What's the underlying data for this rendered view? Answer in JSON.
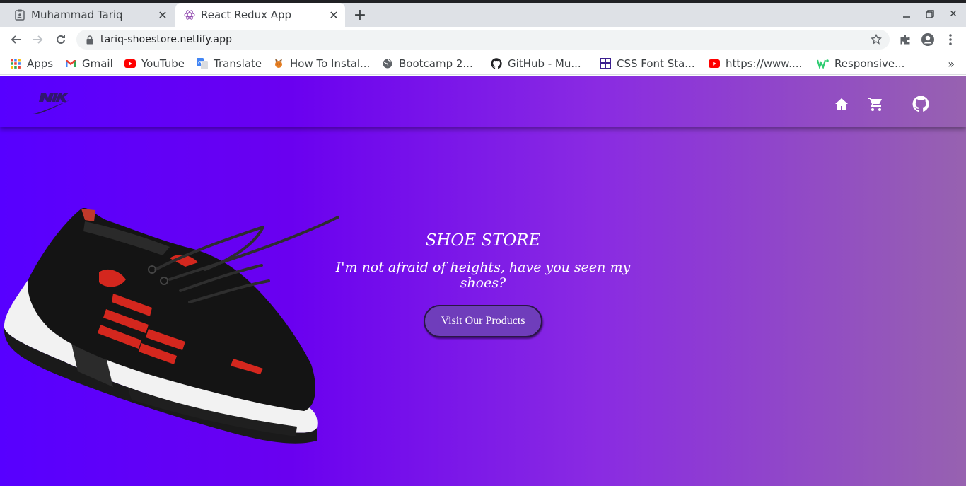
{
  "browser": {
    "tabs": [
      {
        "title": "Muhammad Tariq",
        "favicon": "clipboard-icon"
      },
      {
        "title": "React Redux App",
        "favicon": "react-icon"
      }
    ],
    "url": "tariq-shoestore.netlify.app",
    "bookmarks": [
      {
        "label": "Apps",
        "icon": "apps-grid-icon"
      },
      {
        "label": "Gmail",
        "icon": "gmail-icon"
      },
      {
        "label": "YouTube",
        "icon": "youtube-icon"
      },
      {
        "label": "Translate",
        "icon": "translate-icon"
      },
      {
        "label": "How To Instal...",
        "icon": "cat-icon"
      },
      {
        "label": "Bootcamp 2...",
        "icon": "globe-icon"
      },
      {
        "label": "GitHub - Mu...",
        "icon": "github-icon"
      },
      {
        "label": "CSS Font Sta...",
        "icon": "cssfont-icon"
      },
      {
        "label": "https://www....",
        "icon": "youtube-icon"
      },
      {
        "label": "Responsive...",
        "icon": "w-icon"
      }
    ]
  },
  "site": {
    "hero": {
      "title": "SHOE STORE",
      "subtitle": "I'm not afraid of heights, have you seen my shoes?",
      "cta_label": "Visit Our Products"
    },
    "colors": {
      "gradient_start": "#5700ff",
      "gradient_end": "#9762b0",
      "button": "#6f3dbb"
    }
  }
}
